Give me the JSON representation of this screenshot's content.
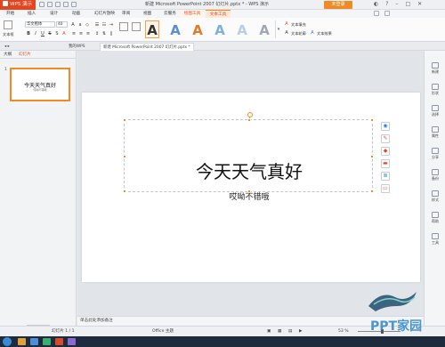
{
  "app": {
    "name": "WPS 演示",
    "window_title": "新建 Microsoft PowerPoint 2007 幻灯片.pptx * - WPS 演示",
    "login_button": "未登录"
  },
  "menu": {
    "tabs": [
      "开始",
      "插入",
      "设计",
      "动画",
      "幻灯片放映",
      "审阅",
      "视图",
      "云服务",
      "绘图工具",
      "文本工具"
    ],
    "active_tab": "文本工具"
  },
  "ribbon": {
    "font_name": "华文楷体",
    "font_size": "40",
    "text_box_label": "文本框",
    "wordart_letter": "A",
    "text_fill": "文本填充",
    "text_outline": "文本轮廓",
    "text_effect": "文本效果"
  },
  "doc_tabs": {
    "home": "我的WPS",
    "current": "新建 Microsoft PowerPoint 2007 幻灯片.pptx *"
  },
  "left_panel": {
    "tab_outline": "大纲",
    "tab_slides": "幻灯片",
    "slide_number": "1",
    "add_slide": "+"
  },
  "slide": {
    "title": "今天天气真好",
    "subtitle": "哎呦不错哦"
  },
  "notes": {
    "placeholder": "单击此处添加备注"
  },
  "right_sidebar": {
    "items": [
      "新建",
      "形状",
      "选择",
      "属性",
      "分享",
      "备份",
      "样式",
      "帮助",
      "工具"
    ]
  },
  "status": {
    "slide_count": "幻灯片 1 / 1",
    "theme": "Office 主题",
    "zoom": "53 %"
  },
  "watermark": {
    "text": "PPT家园"
  },
  "colors": {
    "accent": "#e8431f",
    "orange": "#f08a24",
    "wordart_1": "#333333",
    "wordart_2": "#5a8fd0",
    "wordart_3": "#e07a2a",
    "wordart_4": "#7fb0e0",
    "wordart_5": "#b9cde4",
    "wordart_6": "#a0a8b3"
  }
}
